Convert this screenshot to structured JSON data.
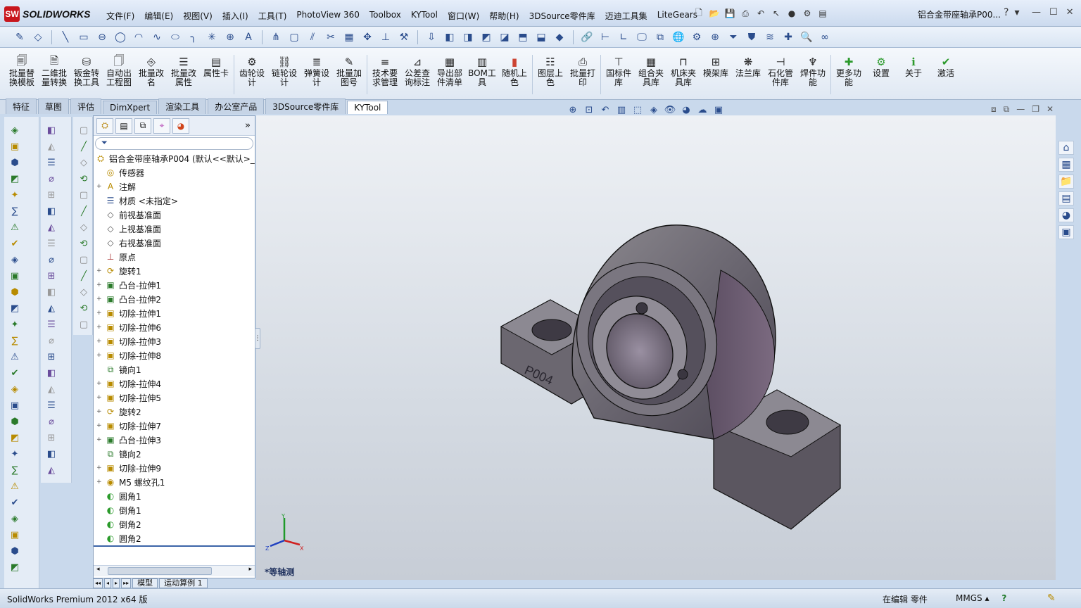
{
  "app": {
    "logo_badge": "SW",
    "logo_text": "SOLIDWORKS",
    "doc_title": "铝合金带座轴承P00...",
    "help": "?",
    "help_arrow": "▾"
  },
  "menus": [
    "文件(F)",
    "编辑(E)",
    "视图(V)",
    "插入(I)",
    "工具(T)",
    "PhotoView 360",
    "Toolbox",
    "KYTool",
    "窗口(W)",
    "帮助(H)",
    "3DSource零件库",
    "迈迪工具集",
    "LiteGears"
  ],
  "ribbon": [
    {
      "icon": "doc-stack-icon",
      "label": "批量替换模板"
    },
    {
      "icon": "convert-icon",
      "label": "二维批量转换"
    },
    {
      "icon": "sheetmetal-icon",
      "label": "钣金转换工具"
    },
    {
      "icon": "drawing-icon",
      "label": "自动出工程图"
    },
    {
      "icon": "rename-icon",
      "label": "批量改名"
    },
    {
      "icon": "properties-icon",
      "label": "批量改属性"
    },
    {
      "icon": "card-icon",
      "label": "属性卡"
    },
    {
      "icon": "gear-icon",
      "label": "齿轮设计"
    },
    {
      "icon": "chain-icon",
      "label": "链轮设计"
    },
    {
      "icon": "spring-icon",
      "label": "弹簧设计"
    },
    {
      "icon": "batch-pic-icon",
      "label": "批量加图号"
    },
    {
      "icon": "tech-icon",
      "label": "技术要求管理"
    },
    {
      "icon": "tolerance-icon",
      "label": "公差查询标注"
    },
    {
      "icon": "export-icon",
      "label": "导出部件清单"
    },
    {
      "icon": "bom-icon",
      "label": "BOM工具"
    },
    {
      "icon": "color-icon",
      "label": "随机上色"
    },
    {
      "icon": "layer-icon",
      "label": "图层上色"
    },
    {
      "icon": "print-icon",
      "label": "批量打印"
    },
    {
      "icon": "standard-icon",
      "label": "国标件库"
    },
    {
      "icon": "fixture-icon",
      "label": "组合夹具库"
    },
    {
      "icon": "machine-icon",
      "label": "机床夹具库"
    },
    {
      "icon": "mold-icon",
      "label": "模架库"
    },
    {
      "icon": "flange-icon",
      "label": "法兰库"
    },
    {
      "icon": "pipe-icon",
      "label": "石化管件库"
    },
    {
      "icon": "weld-icon",
      "label": "焊件功能"
    },
    {
      "icon": "plus-icon",
      "label": "更多功能"
    },
    {
      "icon": "settings-icon",
      "label": "设置"
    },
    {
      "icon": "info-icon",
      "label": "关于"
    },
    {
      "icon": "activate-icon",
      "label": "激活"
    }
  ],
  "tabs": [
    "特征",
    "草图",
    "评估",
    "DimXpert",
    "渲染工具",
    "办公室产品",
    "3DSource零件库",
    "KYTool"
  ],
  "active_tab": "KYTool",
  "tree": {
    "root": "铝合金带座轴承P004 (默认<<默认>_",
    "items": [
      {
        "exp": "",
        "icon": "sensor",
        "label": "传感器"
      },
      {
        "exp": "+",
        "icon": "annotation",
        "label": "注解"
      },
      {
        "exp": "",
        "icon": "material",
        "label": "材质 <未指定>"
      },
      {
        "exp": "",
        "icon": "plane",
        "label": "前视基准面"
      },
      {
        "exp": "",
        "icon": "plane",
        "label": "上视基准面"
      },
      {
        "exp": "",
        "icon": "plane",
        "label": "右视基准面"
      },
      {
        "exp": "",
        "icon": "origin",
        "label": "原点"
      },
      {
        "exp": "+",
        "icon": "revolve",
        "label": "旋转1"
      },
      {
        "exp": "+",
        "icon": "boss",
        "label": "凸台-拉伸1"
      },
      {
        "exp": "+",
        "icon": "boss",
        "label": "凸台-拉伸2"
      },
      {
        "exp": "+",
        "icon": "cut",
        "label": "切除-拉伸1"
      },
      {
        "exp": "+",
        "icon": "cut",
        "label": "切除-拉伸6"
      },
      {
        "exp": "+",
        "icon": "cut",
        "label": "切除-拉伸3"
      },
      {
        "exp": "+",
        "icon": "cut",
        "label": "切除-拉伸8"
      },
      {
        "exp": "",
        "icon": "mirror",
        "label": "镜向1"
      },
      {
        "exp": "+",
        "icon": "cut",
        "label": "切除-拉伸4"
      },
      {
        "exp": "+",
        "icon": "cut",
        "label": "切除-拉伸5"
      },
      {
        "exp": "+",
        "icon": "revolve",
        "label": "旋转2"
      },
      {
        "exp": "+",
        "icon": "cut",
        "label": "切除-拉伸7"
      },
      {
        "exp": "+",
        "icon": "boss",
        "label": "凸台-拉伸3"
      },
      {
        "exp": "",
        "icon": "mirror",
        "label": "镜向2"
      },
      {
        "exp": "+",
        "icon": "cut",
        "label": "切除-拉伸9"
      },
      {
        "exp": "+",
        "icon": "hole",
        "label": "M5 螺纹孔1"
      },
      {
        "exp": "",
        "icon": "fillet",
        "label": "圆角1"
      },
      {
        "exp": "",
        "icon": "fillet",
        "label": "倒角1"
      },
      {
        "exp": "",
        "icon": "fillet",
        "label": "倒角2"
      },
      {
        "exp": "",
        "icon": "fillet",
        "label": "圆角2"
      }
    ]
  },
  "bottom_tabs": [
    "模型",
    "运动算例 1"
  ],
  "part_label": "P004",
  "triad": {
    "x": "X",
    "y": "Y",
    "z": "Z"
  },
  "view_label": "*等轴测",
  "status": {
    "left": "SolidWorks Premium 2012 x64 版",
    "editing": "在编辑 零件",
    "units": "MMGS",
    "units_arrow": "▴",
    "help": "?"
  },
  "colors": {
    "accent": "#3b64a8",
    "model": "#6f6a72",
    "model_dark": "#4c4650",
    "logo": "#c8161d"
  }
}
